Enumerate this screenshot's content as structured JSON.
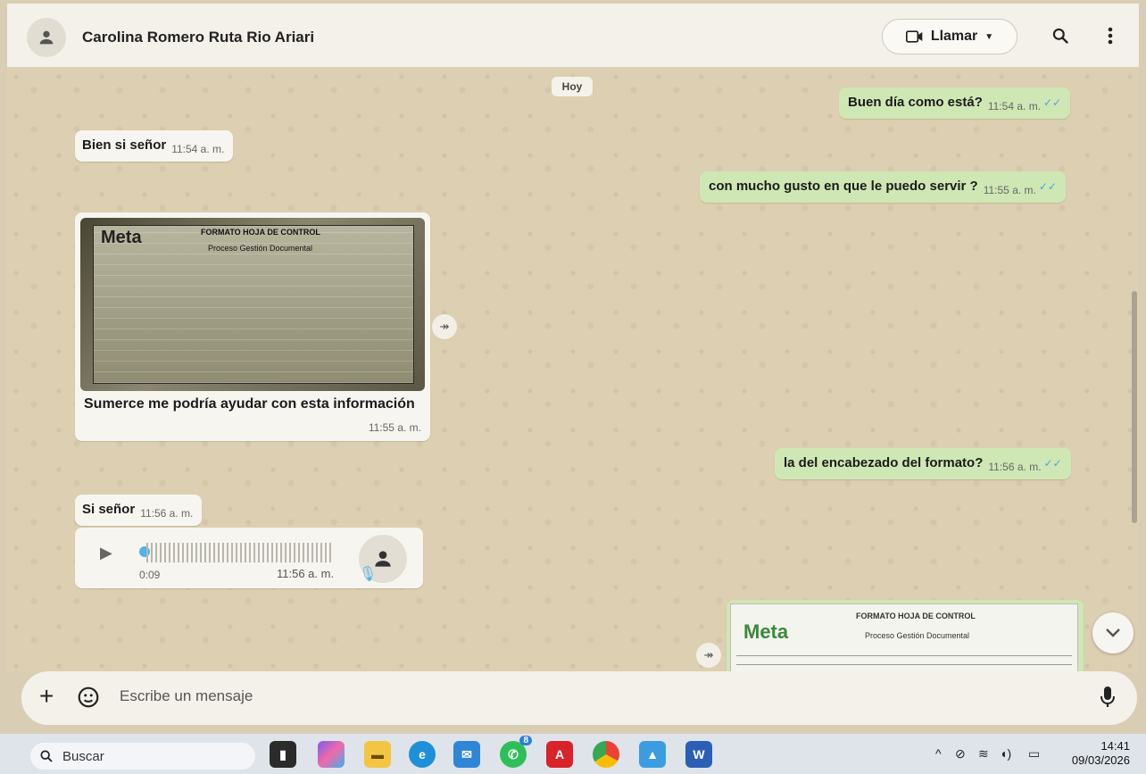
{
  "header": {
    "contact_name": "Carolina Romero Ruta Rio Ariari",
    "call_label": "Llamar",
    "icons": [
      "avatar-icon",
      "video-icon",
      "chevron-down-icon",
      "search-icon",
      "more-vertical-icon"
    ]
  },
  "chat": {
    "date_chip": "Hoy",
    "messages": [
      {
        "dir": "out",
        "text": "Buen día como está?",
        "time": "11:54 a. m."
      },
      {
        "dir": "in",
        "text": "Bien si señor",
        "time": "11:54 a. m."
      },
      {
        "dir": "out",
        "text": "con mucho gusto en que le puedo servir ?",
        "time": "11:55 a. m."
      },
      {
        "dir": "in",
        "type": "image",
        "caption": "Sumerce me podría ayudar con esta información",
        "time": "11:55 a. m.",
        "image_logo": "Meta",
        "image_title": "FORMATO HOJA DE CONTROL",
        "image_subtitle": "Proceso Gestión Documental"
      },
      {
        "dir": "out",
        "text": "la del encabezado del formato?",
        "time": "11:56 a. m."
      },
      {
        "dir": "in",
        "text": "Si señor",
        "time": "11:56 a. m."
      },
      {
        "dir": "in",
        "type": "voice",
        "duration": "0:09",
        "time": "11:56 a. m."
      },
      {
        "dir": "out",
        "type": "image",
        "image_logo": "Meta",
        "image_title": "FORMATO HOJA DE CONTROL",
        "image_subtitle": "Proceso Gestión Documental"
      }
    ]
  },
  "composer": {
    "placeholder": "Escribe un mensaje"
  },
  "taskbar": {
    "search_label": "Buscar",
    "time": "14:41",
    "date": "09/03/2026",
    "whatsapp_badge": "8"
  },
  "colors": {
    "outgoing_bubble": "#cfe7b4",
    "incoming_bubble": "#f7f5ef",
    "read_ticks": "#4aa3df",
    "chat_background": "#dccfb2"
  }
}
